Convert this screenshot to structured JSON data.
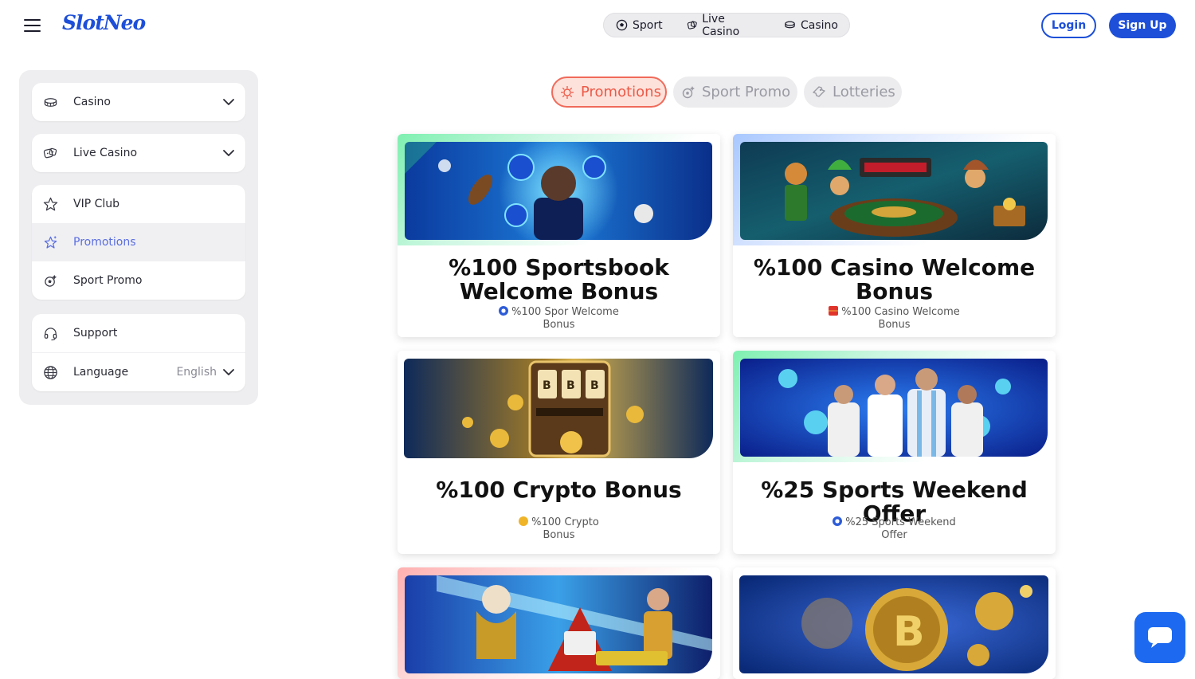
{
  "header": {
    "logo": "SlotNeo",
    "nav": [
      {
        "label": "Sport",
        "icon": "soccer-ball-icon"
      },
      {
        "label": "Live Casino",
        "icon": "live-dice-icon"
      },
      {
        "label": "Casino",
        "icon": "casino-chips-icon"
      }
    ],
    "login_label": "Login",
    "signup_label": "Sign Up"
  },
  "sidebar": {
    "casino": "Casino",
    "live_casino": "Live Casino",
    "vip_club": "VIP Club",
    "promotions": "Promotions",
    "sport_promo": "Sport Promo",
    "support": "Support",
    "language": "Language",
    "language_value": "English"
  },
  "tabs": {
    "promotions": "Promotions",
    "sport_promo": "Sport Promo",
    "lotteries": "Lotteries"
  },
  "cards": [
    {
      "title": "%100 Sportsbook Welcome Bonus",
      "subtitle_line1": "%100 Spor Welcome",
      "subtitle_line2": "Bonus",
      "icon": "soccer-ball-icon"
    },
    {
      "title": "%100 Casino Welcome Bonus",
      "subtitle_line1": "%100 Casino Welcome",
      "subtitle_line2": "Bonus",
      "icon": "gift-icon"
    },
    {
      "title": "%100 Crypto Bonus",
      "subtitle_line1": "%100 Crypto",
      "subtitle_line2": "Bonus",
      "icon": "coin-icon"
    },
    {
      "title": "%25 Sports Weekend Offer",
      "subtitle_line1": "%25 Sports Weekend",
      "subtitle_line2": "Offer",
      "icon": "soccer-ball-icon"
    }
  ],
  "colors": {
    "brand": "#1d4fd8",
    "active_tab": "#ec5a47",
    "sidebar_active": "#5a6ee0",
    "chat_button": "#1d6af0"
  }
}
